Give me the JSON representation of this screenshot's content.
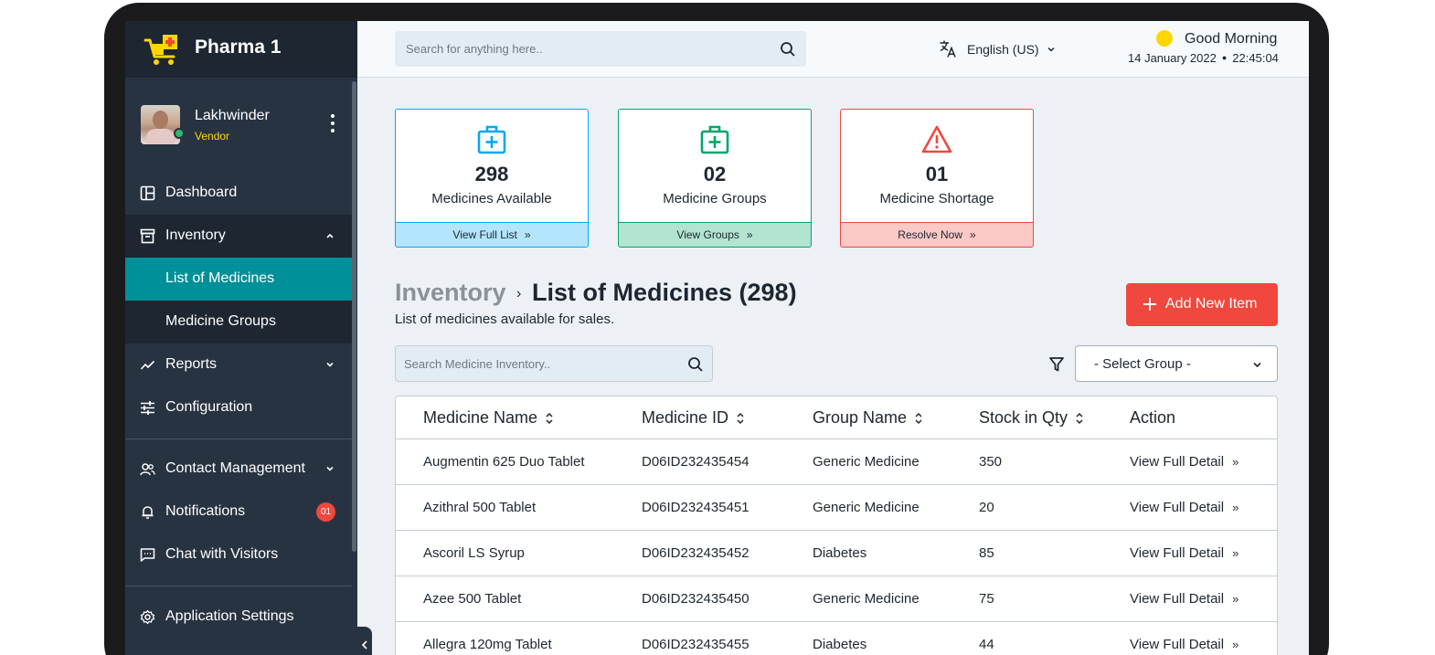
{
  "app": {
    "name": "Pharma 1"
  },
  "user": {
    "name": "Lakhwinder",
    "role": "Vendor"
  },
  "nav": {
    "dashboard": "Dashboard",
    "inventory": "Inventory",
    "list_of_medicines": "List of Medicines",
    "medicine_groups": "Medicine Groups",
    "reports": "Reports",
    "configuration": "Configuration",
    "contact_management": "Contact Management",
    "notifications": "Notifications",
    "notifications_count": "01",
    "chat_with_visitors": "Chat with Visitors",
    "application_settings": "Application Settings"
  },
  "header": {
    "search_placeholder": "Search for anything here..",
    "language": "English (US)",
    "greeting": "Good Morning",
    "date": "14 January 2022",
    "time": "22:45:04"
  },
  "cards": [
    {
      "value": "298",
      "caption": "Medicines Available",
      "action": "View Full List",
      "color": "#03a9f5"
    },
    {
      "value": "02",
      "caption": "Medicine Groups",
      "action": "View Groups",
      "color": "#01a768"
    },
    {
      "value": "01",
      "caption": "Medicine Shortage",
      "action": "Resolve Now",
      "color": "#f0483e"
    }
  ],
  "page": {
    "breadcrumb_parent": "Inventory",
    "title": "List of Medicines (298)",
    "subtitle": "List of medicines available for sales.",
    "add_button": "Add New Item",
    "search_placeholder": "Search Medicine Inventory..",
    "group_select": "- Select Group -"
  },
  "table": {
    "columns": [
      "Medicine Name",
      "Medicine ID",
      "Group Name",
      "Stock in Qty",
      "Action"
    ],
    "rows": [
      [
        "Augmentin 625 Duo Tablet",
        "D06ID232435454",
        "Generic Medicine",
        "350",
        "View Full Detail"
      ],
      [
        "Azithral 500 Tablet",
        "D06ID232435451",
        "Generic Medicine",
        "20",
        "View Full Detail"
      ],
      [
        "Ascoril LS Syrup",
        "D06ID232435452",
        "Diabetes",
        "85",
        "View Full Detail"
      ],
      [
        "Azee 500 Tablet",
        "D06ID232435450",
        "Generic Medicine",
        "75",
        "View Full Detail"
      ],
      [
        "Allegra 120mg Tablet",
        "D06ID232435455",
        "Diabetes",
        "44",
        "View Full Detail"
      ]
    ]
  },
  "colors": {
    "sidebar": "#283342",
    "sidebar_dark": "#1d2631",
    "active": "#009099",
    "accent_red": "#f0483e",
    "accent_yellow": "#fed600"
  },
  "icons": {
    "brand": "cart-plus-icon",
    "dashboard": "dashboard-icon",
    "inventory": "inventory-icon",
    "reports": "chart-line-icon",
    "configuration": "sliders-icon",
    "contact_management": "users-icon",
    "notifications": "bell-icon",
    "chat": "chat-icon",
    "settings": "gear-icon",
    "search": "search-icon",
    "language": "translate-icon",
    "filter": "filter-icon",
    "sort": "sort-icon"
  }
}
